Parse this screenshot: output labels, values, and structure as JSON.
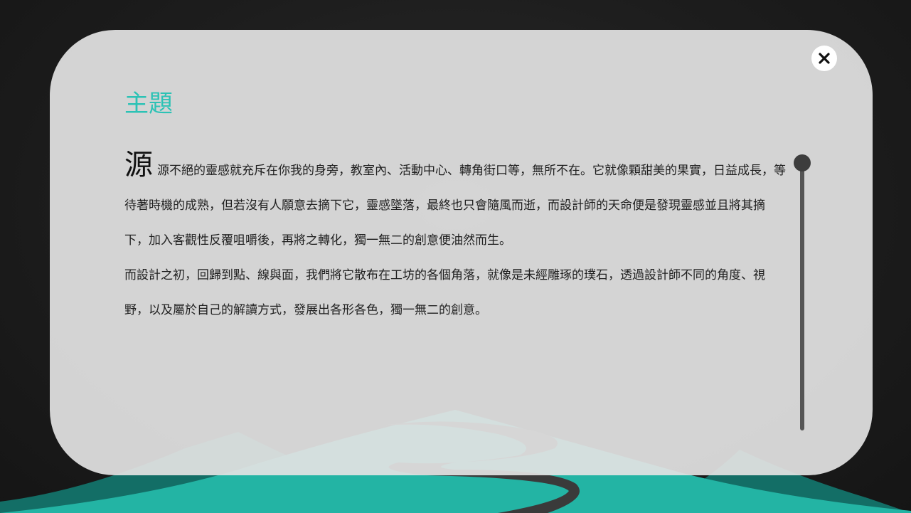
{
  "modal": {
    "title": "主題",
    "drop_cap": "源",
    "paragraph_1": "源不絕的靈感就充斥在你我的身旁，教室內、活動中心、轉角街口等，無所不在。它就像顆甜美的果實，日益成長，等待著時機的成熟，但若沒有人願意去摘下它，靈感墜落，最終也只會隨風而逝，而設計師的天命便是發現靈感並且將其摘下，加入客觀性反覆咀嚼後，再將之轉化，獨一無二的創意便油然而生。",
    "paragraph_2": "而設計之初，回歸到點、線與面，我們將它散布在工坊的各個角落，就像是未經雕琢的璞石，透過設計師不同的角度、視野，以及屬於自己的解讀方式，發展出各形各色，獨一無二的創意。",
    "close_icon": "close-icon"
  },
  "colors": {
    "title_accent": "#2cc2b5",
    "hill_teal": "#23b4a4",
    "hill_dark": "#136e66",
    "modal_bg": "#e2e2e2",
    "page_bg": "#1c1c1c"
  }
}
